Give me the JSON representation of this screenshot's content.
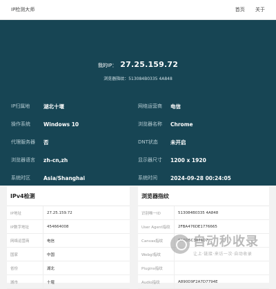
{
  "header": {
    "site_title": "IP检测大师",
    "nav": [
      "首页",
      "关于"
    ]
  },
  "hero": {
    "ip_label": "我的IP：",
    "ip_value": "27.25.159.72",
    "fingerprint_text": "浏览器指纹：513084B0335 4A848"
  },
  "info": [
    {
      "key": "IP归属地",
      "value": "湖北十堰"
    },
    {
      "key": "网络运营商",
      "value": "电信"
    },
    {
      "key": "操作系统",
      "value": "Windows 10"
    },
    {
      "key": "浏览器名称",
      "value": "Chrome"
    },
    {
      "key": "代理服务器",
      "value": "否"
    },
    {
      "key": "DNT状态",
      "value": "未开启"
    },
    {
      "key": "浏览器语言",
      "value": "zh-cn,zh"
    },
    {
      "key": "显示器尺寸",
      "value": "1200 x 1920"
    },
    {
      "key": "系统时区",
      "value": "Asia/Shanghai"
    },
    {
      "key": "系统时间",
      "value": "2024-09-28 00:24:05"
    }
  ],
  "ipv4_card": {
    "title": "IPv4检测",
    "rows": [
      {
        "key": "IP地址",
        "value": "27.25.159.72"
      },
      {
        "key": "IP数字地址",
        "value": "454664008"
      },
      {
        "key": "网络运营商",
        "value": "电信"
      },
      {
        "key": "国家",
        "value": "中国"
      },
      {
        "key": "省份",
        "value": "湖北"
      },
      {
        "key": "城市",
        "value": "十堰"
      }
    ]
  },
  "fp_card": {
    "title": "浏览器指纹",
    "rows": [
      {
        "key": "识别唯一ID",
        "value": "513084B0335 4A848"
      },
      {
        "key": "User Agent指纹",
        "value": "2FBA476DE1776665"
      },
      {
        "key": "Canvas指纹",
        "value": "8A5D5C307107"
      },
      {
        "key": "Webgl指纹",
        "value": ""
      },
      {
        "key": "Plugins指纹",
        "value": ""
      },
      {
        "key": "Audio指纹",
        "value": "A890D9F2A7D7794E"
      }
    ]
  },
  "watermark": {
    "title": "自动秒收录",
    "subtitle": "让上·链接·来访一次·自动收录"
  }
}
